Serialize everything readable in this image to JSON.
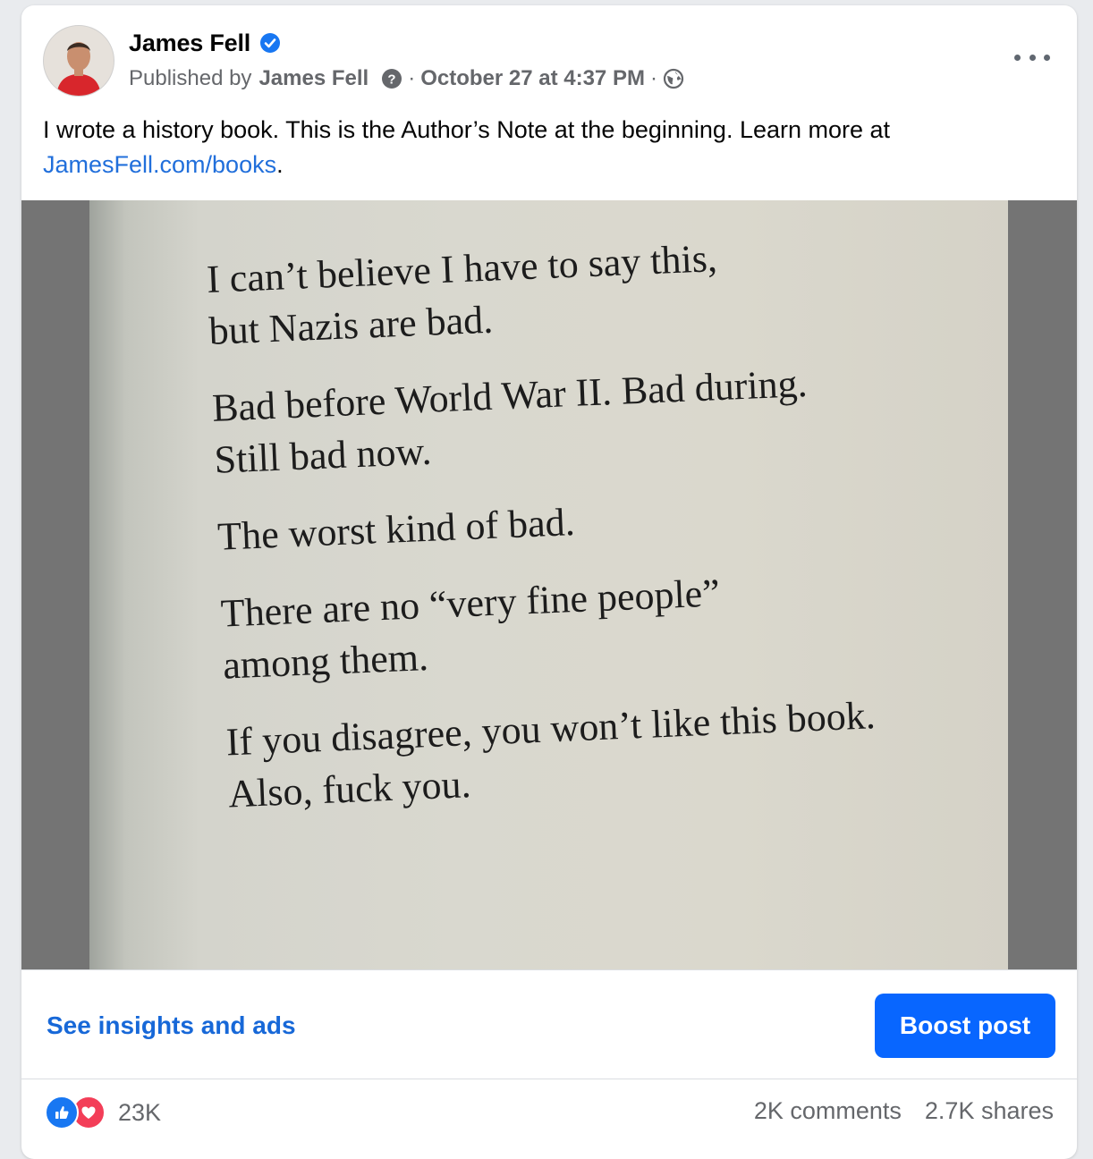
{
  "post": {
    "author_name": "James Fell",
    "published_by_prefix": "Published by",
    "publisher_name": "James Fell",
    "separator": "·",
    "date": "October 27 at 4:37 PM",
    "text_main": "I wrote a history book. This is the Author’s Note at the beginning. Learn more at",
    "text_link": "JamesFell.com/books",
    "text_end": "."
  },
  "photo": {
    "lines": [
      [
        "I can’t believe I have to say this,",
        "but Nazis are bad."
      ],
      [
        "Bad before World War II. Bad during.",
        "Still bad now."
      ],
      [
        "The worst kind of bad."
      ],
      [
        "There are no “very fine people”",
        "among them."
      ],
      [
        "If you disagree, you won’t like this book.",
        "Also, fuck you."
      ]
    ]
  },
  "actions": {
    "insights_label": "See insights and ads",
    "boost_label": "Boost post"
  },
  "stats": {
    "reaction_count": "23K",
    "comments": "2K comments",
    "shares": "2.7K shares"
  },
  "icons": {
    "verified": "verified-badge-icon",
    "help": "question-circle-icon",
    "audience": "globe-icon",
    "more": "more-horizontal-icon",
    "like": "like-reaction-icon",
    "love": "love-reaction-icon"
  },
  "colors": {
    "link": "#216fdb",
    "boost": "#0866ff",
    "verified": "#1877f2",
    "like": "#1877f2",
    "love": "#f33e58",
    "meta_text": "#65676b"
  }
}
